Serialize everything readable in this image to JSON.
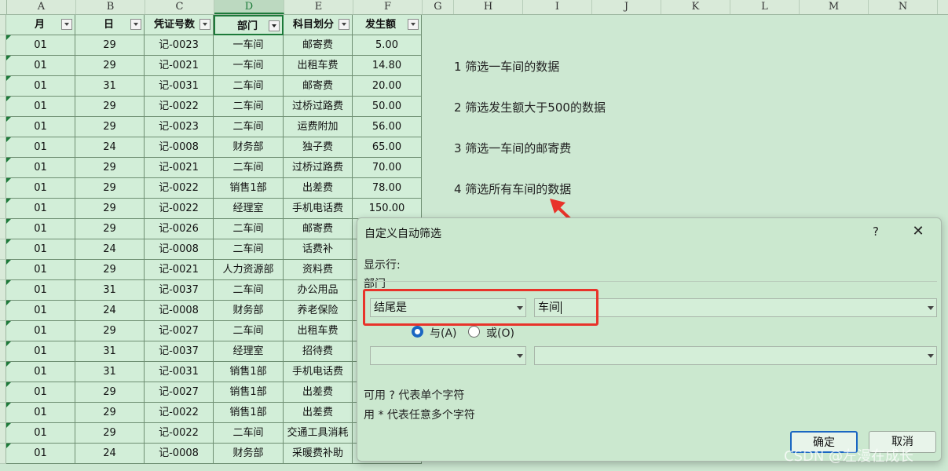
{
  "columns": [
    "A",
    "B",
    "C",
    "D",
    "E",
    "F",
    "G",
    "H",
    "I",
    "J",
    "K",
    "L",
    "M",
    "N"
  ],
  "header_row": [
    "月",
    "日",
    "凭证号数",
    "部门",
    "科目划分",
    "发生额"
  ],
  "rows": [
    [
      "01",
      "29",
      "记-0023",
      "一车间",
      "邮寄费",
      "5.00"
    ],
    [
      "01",
      "29",
      "记-0021",
      "一车间",
      "出租车费",
      "14.80"
    ],
    [
      "01",
      "31",
      "记-0031",
      "二车间",
      "邮寄费",
      "20.00"
    ],
    [
      "01",
      "29",
      "记-0022",
      "二车间",
      "过桥过路费",
      "50.00"
    ],
    [
      "01",
      "29",
      "记-0023",
      "二车间",
      "运费附加",
      "56.00"
    ],
    [
      "01",
      "24",
      "记-0008",
      "财务部",
      "独子费",
      "65.00"
    ],
    [
      "01",
      "29",
      "记-0021",
      "二车间",
      "过桥过路费",
      "70.00"
    ],
    [
      "01",
      "29",
      "记-0022",
      "销售1部",
      "出差费",
      "78.00"
    ],
    [
      "01",
      "29",
      "记-0022",
      "经理室",
      "手机电话费",
      "150.00"
    ],
    [
      "01",
      "29",
      "记-0026",
      "二车间",
      "邮寄费",
      ""
    ],
    [
      "01",
      "24",
      "记-0008",
      "二车间",
      "话费补",
      ""
    ],
    [
      "01",
      "29",
      "记-0021",
      "人力资源部",
      "资料费",
      ""
    ],
    [
      "01",
      "31",
      "记-0037",
      "二车间",
      "办公用品",
      ""
    ],
    [
      "01",
      "24",
      "记-0008",
      "财务部",
      "养老保险",
      ""
    ],
    [
      "01",
      "29",
      "记-0027",
      "二车间",
      "出租车费",
      ""
    ],
    [
      "01",
      "31",
      "记-0037",
      "经理室",
      "招待费",
      ""
    ],
    [
      "01",
      "31",
      "记-0031",
      "销售1部",
      "手机电话费",
      ""
    ],
    [
      "01",
      "29",
      "记-0027",
      "销售1部",
      "出差费",
      ""
    ],
    [
      "01",
      "29",
      "记-0022",
      "销售1部",
      "出差费",
      ""
    ],
    [
      "01",
      "29",
      "记-0022",
      "二车间",
      "交通工具消耗",
      ""
    ],
    [
      "01",
      "24",
      "记-0008",
      "财务部",
      "采暖费补助",
      ""
    ]
  ],
  "notes": [
    "1 筛选一车间的数据",
    "2 筛选发生额大于500的数据",
    "3 筛选一车间的邮寄费",
    "4 筛选所有车间的数据"
  ],
  "dialog": {
    "title": "自定义自动筛选",
    "help": "?",
    "close": "✕",
    "show_rows_label": "显示行:",
    "field_label": "部门",
    "condition1_operator": "结尾是",
    "condition1_value": "车间",
    "and_label": "与(A)",
    "or_label": "或(O)",
    "condition2_operator": "",
    "condition2_value": "",
    "hint1": "可用 ? 代表单个字符",
    "hint2": "用 * 代表任意多个字符",
    "ok": "确定",
    "cancel": "取消"
  },
  "watermark": "CSDN @左漫在成长",
  "colors": {
    "accent": "#1d7a3a",
    "highlight": "#e8332a",
    "sheet_bg": "#cde8d2"
  }
}
